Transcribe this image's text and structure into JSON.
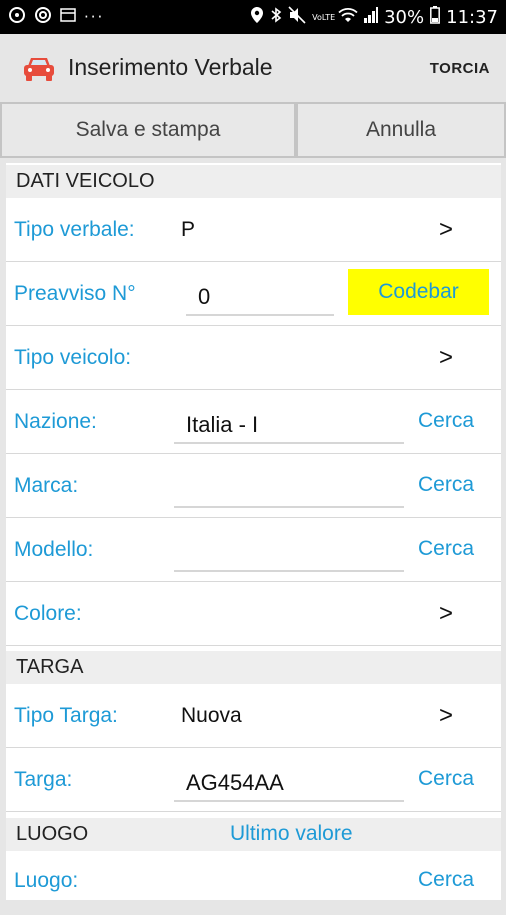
{
  "status_bar": {
    "left_icons": [
      "notification-icon-1",
      "notification-icon-2",
      "notification-icon-3",
      "more-icon"
    ],
    "right_icons": [
      "location-icon",
      "bluetooth-icon",
      "mute-icon",
      "volte-icon",
      "wifi-icon",
      "signal-icon"
    ],
    "volte": "VoLTE",
    "battery": "30%",
    "time": "11:37"
  },
  "app_bar": {
    "icon": "car-icon",
    "title": "Inserimento Verbale",
    "action": "TORCIA"
  },
  "buttons": {
    "save": "Salva e stampa",
    "cancel": "Annulla"
  },
  "sections": {
    "vehicle": "DATI VEICOLO",
    "plate": "TARGA",
    "place": "LUOGO",
    "place_last": "Ultimo valore"
  },
  "fields": {
    "tipo_verbale": {
      "label": "Tipo verbale:",
      "value": "P",
      "action": ">"
    },
    "preavviso": {
      "label": "Preavviso N°",
      "value": "0",
      "action": "Codebar"
    },
    "tipo_veicolo": {
      "label": "Tipo veicolo:",
      "value": "",
      "action": ">"
    },
    "nazione": {
      "label": "Nazione:",
      "value": "Italia - I",
      "action": "Cerca"
    },
    "marca": {
      "label": "Marca:",
      "value": "",
      "action": "Cerca"
    },
    "modello": {
      "label": "Modello:",
      "value": "",
      "action": "Cerca"
    },
    "colore": {
      "label": "Colore:",
      "value": "",
      "action": ">"
    },
    "tipo_targa": {
      "label": "Tipo Targa:",
      "value": "Nuova",
      "action": ">"
    },
    "targa": {
      "label": "Targa:",
      "value": "AG454AA",
      "action": "Cerca"
    },
    "luogo": {
      "label": "Luogo:",
      "value": "",
      "action": "Cerca"
    }
  },
  "colors": {
    "accent": "#1e9ad6",
    "codebar_bg": "#ffff00",
    "car_icon": "#e74c3c"
  }
}
